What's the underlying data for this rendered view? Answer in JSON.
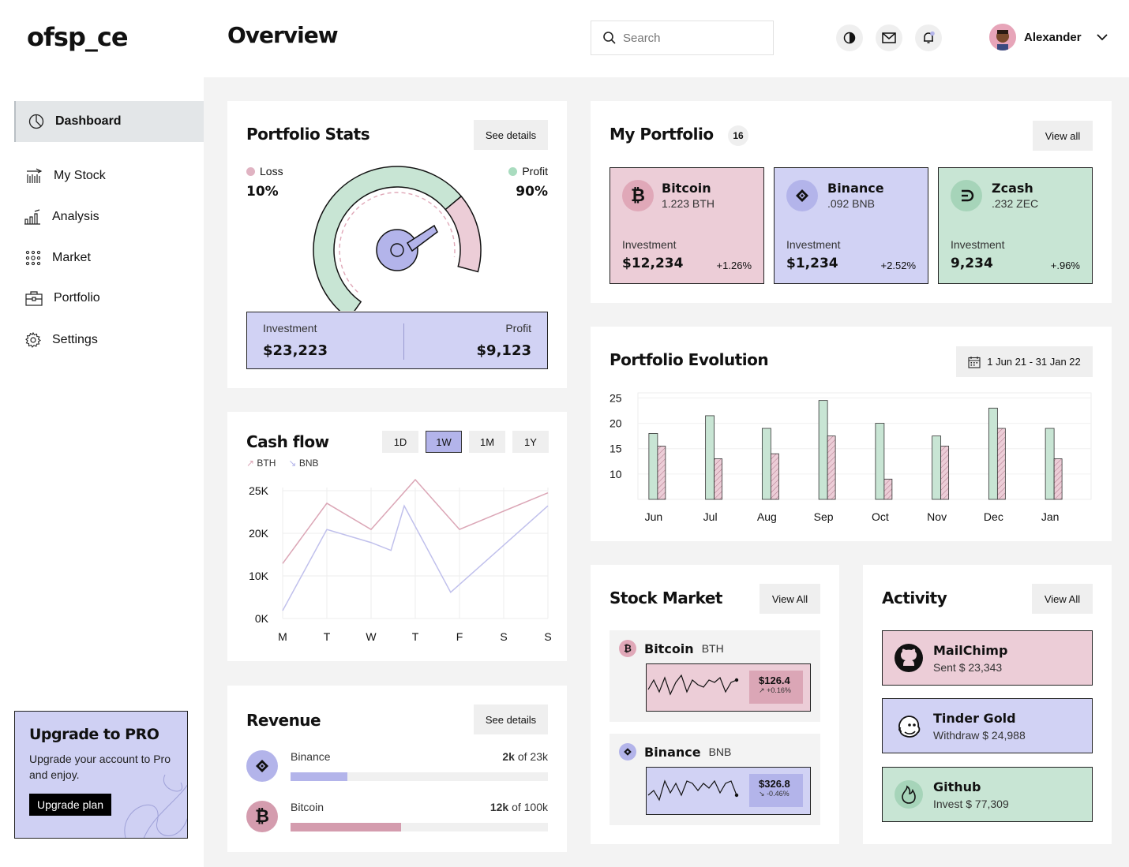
{
  "app": {
    "logo": "ofsp_ce",
    "page_title": "Overview"
  },
  "header": {
    "search_placeholder": "Search",
    "user_name": "Alexander",
    "icons": [
      "contrast-icon",
      "mail-icon",
      "bell-icon",
      "chevron-down-icon"
    ]
  },
  "sidebar": {
    "items": [
      {
        "label": "Dashboard",
        "icon": "pie-chart-icon"
      },
      {
        "label": "My Stock",
        "icon": "stock-icon"
      },
      {
        "label": "Analysis",
        "icon": "bar-chart-icon"
      },
      {
        "label": "Market",
        "icon": "market-icon"
      },
      {
        "label": "Portfolio",
        "icon": "briefcase-icon"
      },
      {
        "label": "Settings",
        "icon": "gear-icon"
      }
    ]
  },
  "upgrade": {
    "title": "Upgrade to PRO",
    "text": "Upgrade your account to Pro and enjoy.",
    "button": "Upgrade plan"
  },
  "stats": {
    "title": "Portfolio Stats",
    "button": "See details",
    "loss_label": "Loss",
    "loss_value": "10%",
    "profit_label": "Profit",
    "profit_value": "90%",
    "gauge_profit_fraction": 0.9,
    "investment_label": "Investment",
    "investment_value": "$23,223",
    "profit_box_label": "Profit",
    "profit_box_value": "$9,123"
  },
  "cashflow": {
    "title": "Cash flow",
    "timeframes": [
      "1D",
      "1W",
      "1M",
      "1Y"
    ],
    "active_timeframe": "1W"
  },
  "revenue": {
    "title": "Revenue",
    "button": "See details",
    "items": [
      {
        "name": "Binance",
        "amount": "2k",
        "of_text": "of 23k",
        "fraction": 0.22,
        "color": "#b3b4ea"
      },
      {
        "name": "Bitcoin",
        "amount": "12k",
        "of_text": "of 100k",
        "fraction": 0.43,
        "color": "#d49cae"
      }
    ]
  },
  "portfolio": {
    "title": "My Portfolio",
    "count": "16",
    "button": "View all",
    "invest_label": "Investment",
    "cards": [
      {
        "name": "Bitcoin",
        "amount": "1.223 BTH",
        "investment": "$12,234",
        "change": "+1.26%",
        "bg": "#eccdd7",
        "coinbg": "#e0a8b8",
        "icon": "bitcoin-icon"
      },
      {
        "name": "Binance",
        "amount": ".092 BNB",
        "investment": "$1,234",
        "change": "+2.52%",
        "bg": "#d1d2f4",
        "coinbg": "#b3b4ea",
        "icon": "binance-icon"
      },
      {
        "name": "Zcash",
        "amount": ".232 ZEC",
        "investment": "9,234",
        "change": "+.96%",
        "bg": "#c8e5d4",
        "coinbg": "#a6d4b9",
        "icon": "zcash-icon"
      }
    ]
  },
  "evolution": {
    "title": "Portfolio Evolution",
    "date_range": "1 Jun 21 - 31 Jan 22"
  },
  "market": {
    "title": "Stock Market",
    "button": "View All",
    "items": [
      {
        "name": "Bitcoin",
        "ticker": "BTH",
        "price": "$126.4",
        "change": "+0.16%",
        "bg": "#eccdd7",
        "chipbg": "#dba6b6"
      },
      {
        "name": "Binance",
        "ticker": "BNB",
        "price": "$326.8",
        "change": "-0.46%",
        "bg": "#d1d2f4",
        "chipbg": "#b3b4ea"
      }
    ]
  },
  "activity": {
    "title": "Activity",
    "button": "View All",
    "items": [
      {
        "name": "MailChimp",
        "desc": "Sent $ 23,343",
        "bg": "#eccdd7",
        "icon": "github-icon"
      },
      {
        "name": "Tinder Gold",
        "desc": "Withdraw $ 24,988",
        "bg": "#d1d2f4",
        "icon": "mailchimp-icon"
      },
      {
        "name": "Github",
        "desc": "Invest $ 77,309",
        "bg": "#c8e5d4",
        "icon": "tinder-icon"
      }
    ]
  },
  "chart_data": [
    {
      "type": "line",
      "title": "Cash flow",
      "categories": [
        "M",
        "T",
        "W",
        "T",
        "F",
        "S",
        "S"
      ],
      "yticks": [
        "0K",
        "10K",
        "20K",
        "25K"
      ],
      "ylim": [
        0,
        25000
      ],
      "series": [
        {
          "name": "BTH",
          "color": "#dba6b6",
          "points": [
            [
              0,
              10500
            ],
            [
              1,
              22000
            ],
            [
              2,
              17000
            ],
            [
              3,
              26500
            ],
            [
              4,
              17000
            ],
            [
              5,
              20500
            ],
            [
              6,
              24000
            ]
          ]
        },
        {
          "name": "BNB",
          "color": "#c0c0ec",
          "points": [
            [
              0,
              1500
            ],
            [
              1,
              17000
            ],
            [
              2,
              14500
            ],
            [
              2.45,
              13000
            ],
            [
              2.75,
              21500
            ],
            [
              3.8,
              5000
            ],
            [
              6,
              21500
            ]
          ]
        }
      ]
    },
    {
      "type": "bar",
      "title": "Portfolio Evolution",
      "categories": [
        "Jun",
        "Jul",
        "Aug",
        "Sep",
        "Oct",
        "Nov",
        "Dec",
        "Jan"
      ],
      "yticks": [
        10,
        15,
        20,
        25
      ],
      "ylim": [
        5,
        26
      ],
      "series": [
        {
          "color": "#c8e5d4",
          "values": [
            18,
            21.5,
            19,
            24.5,
            20,
            17.5,
            23,
            19
          ]
        },
        {
          "color": "#eccdd7",
          "values": [
            15.5,
            13,
            14,
            17.5,
            9,
            15.5,
            19,
            13
          ]
        }
      ]
    },
    {
      "type": "line",
      "title": "Bitcoin sparkline",
      "values": [
        6,
        10,
        5,
        11,
        4,
        9,
        12,
        5,
        10,
        8,
        7,
        10,
        9,
        11,
        5,
        9,
        10
      ]
    },
    {
      "type": "line",
      "title": "Binance sparkline",
      "values": [
        5,
        7,
        3,
        11,
        6,
        10,
        5,
        11,
        10,
        7,
        10,
        8,
        11,
        6,
        10,
        11,
        5
      ]
    }
  ]
}
